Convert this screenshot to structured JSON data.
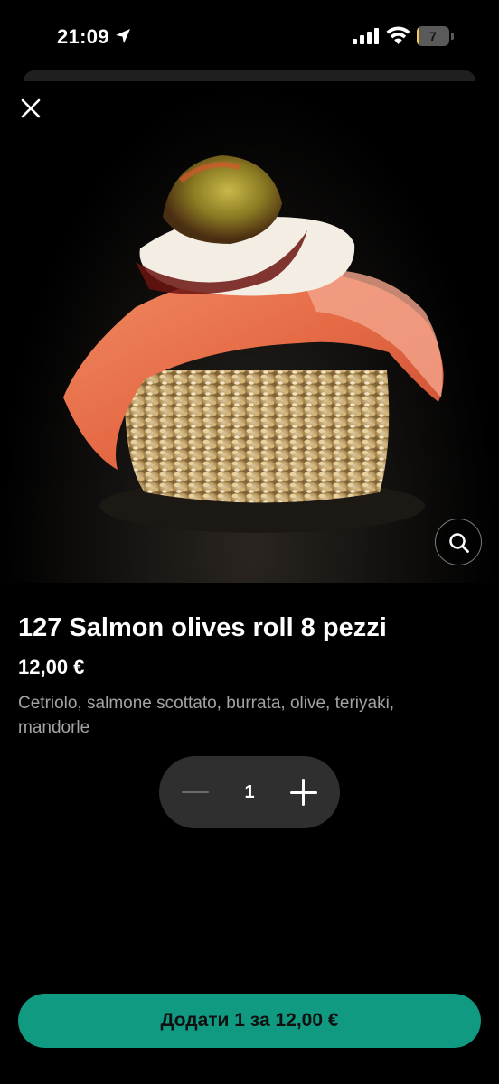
{
  "status_bar": {
    "time": "21:09",
    "battery_level": "7",
    "battery_fraction": 0.07,
    "icons": [
      "location-arrow-icon",
      "signal-icon",
      "wifi-icon",
      "battery-icon"
    ]
  },
  "product": {
    "title": "127 Salmon olives roll 8 pezzi",
    "price": "12,00 €",
    "description": "Cetriolo, salmone scottato, burrata, olive, teriyaki, mandorle"
  },
  "quantity": {
    "value": "1"
  },
  "add_button": {
    "label": "Додати 1 за 12,00 €"
  },
  "colors": {
    "background": "#000000",
    "accent": "#109a82",
    "stepper_bg": "#2f2f2f",
    "description_text": "#a3a3a3"
  },
  "icons": {
    "close": "close-icon",
    "zoom": "search-icon"
  }
}
